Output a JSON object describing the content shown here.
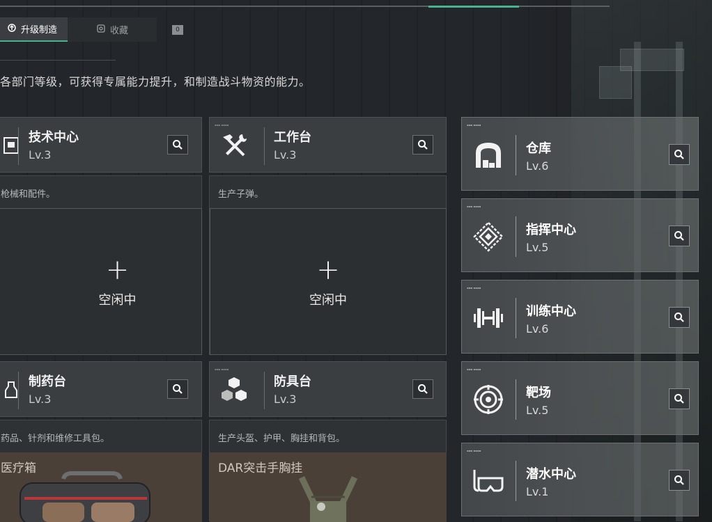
{
  "tabs": {
    "upgrade_craft": "升级制造",
    "favorites": "收藏",
    "badge": "0"
  },
  "description": "各部门等级，可获得专属能力提升，和制造战斗物资的能力。",
  "facilities": {
    "tech": {
      "name": "技术中心",
      "level": "Lv.3",
      "desc": "枪械和配件。",
      "slot_status": "空闲中",
      "slot_plus": "+"
    },
    "workbench": {
      "name": "工作台",
      "level": "Lv.3",
      "desc": "生产子弹。",
      "slot_status": "空闲中",
      "slot_plus": "+"
    },
    "pharmacy": {
      "name": "制药台",
      "level": "Lv.3",
      "desc": "药品、针剂和维修工具包。",
      "preview_item": "医疗箱"
    },
    "armor": {
      "name": "防具台",
      "level": "Lv.3",
      "desc": "生产头盔、护甲、胸挂和背包。",
      "preview_item": "DAR突击手胸挂"
    }
  },
  "right_facilities": [
    {
      "name": "仓库",
      "level": "Lv.6",
      "icon": "warehouse-icon"
    },
    {
      "name": "指挥中心",
      "level": "Lv.5",
      "icon": "command-center-icon"
    },
    {
      "name": "训练中心",
      "level": "Lv.6",
      "icon": "dumbbell-icon"
    },
    {
      "name": "靶场",
      "level": "Lv.5",
      "icon": "target-icon"
    },
    {
      "name": "潜水中心",
      "level": "Lv.1",
      "icon": "diving-mask-icon"
    }
  ],
  "colors": {
    "accent": "#49b38a",
    "panel": "#3b3e41",
    "preview_bg": "#4b4038"
  }
}
